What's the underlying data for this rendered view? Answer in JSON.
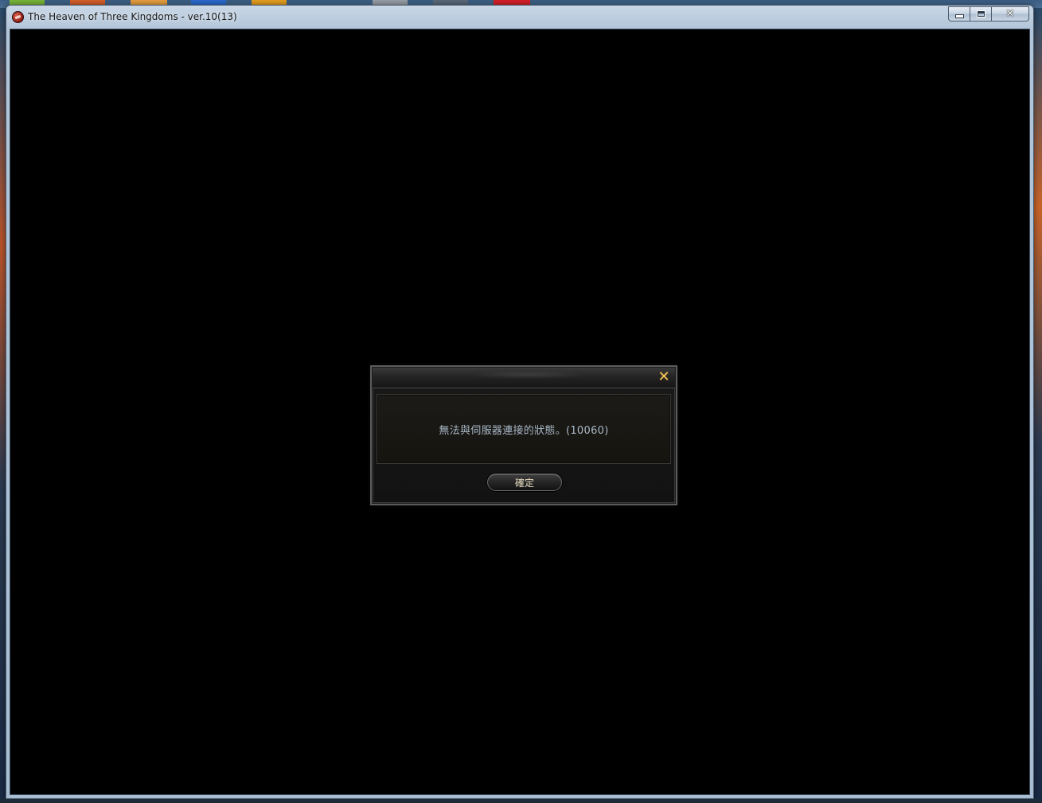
{
  "window": {
    "title": "The Heaven of Three Kingdoms - ver.10(13)",
    "caption_buttons": {
      "minimize_icon": "minimize-icon",
      "maximize_icon": "maximize-icon",
      "close_icon": "close-icon",
      "close_glyph": "✕"
    }
  },
  "dialog": {
    "message": "無法與伺服器連接的狀態。(10060)",
    "close_glyph": "✕",
    "ok_label": "確定",
    "colors": {
      "close_x": "#f0c860",
      "message_text": "#a9b8c6",
      "ok_text": "#e9dcc0"
    }
  }
}
